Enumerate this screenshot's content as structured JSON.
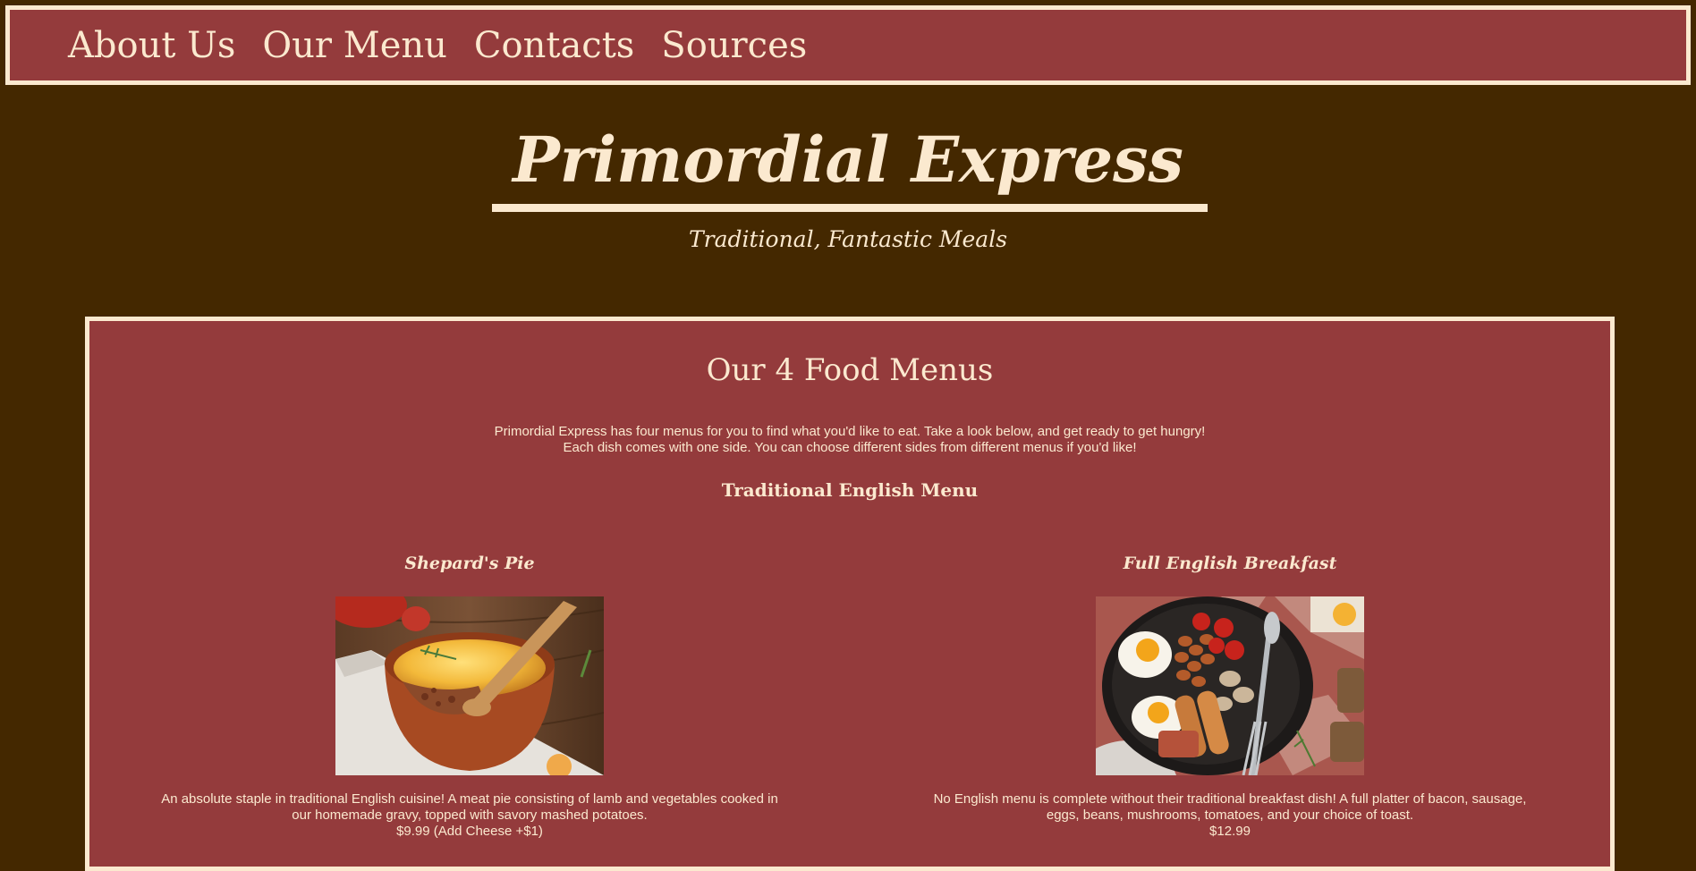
{
  "nav": {
    "items": [
      {
        "label": "About Us"
      },
      {
        "label": "Our Menu"
      },
      {
        "label": "Contacts"
      },
      {
        "label": "Sources"
      }
    ]
  },
  "header": {
    "title": "Primordial Express",
    "tagline": "Traditional, Fantastic Meals"
  },
  "main": {
    "heading": "Our 4 Food Menus",
    "intro_line1": "Primordial Express has four menus for you to find what you'd like to eat. Take a look below, and get ready to get hungry!",
    "intro_line2": "Each dish comes with one side. You can choose different sides from different menus if you'd like!",
    "menu_title": "Traditional English Menu",
    "dishes": [
      {
        "name": "Shepard's Pie",
        "image_icon": "shepherds-pie-photo",
        "description": "An absolute staple in traditional English cuisine! A meat pie consisting of lamb and vegetables cooked in our homemade gravy, topped with savory mashed potatoes.",
        "price": "$9.99 (Add Cheese +$1)"
      },
      {
        "name": "Full English Breakfast",
        "image_icon": "english-breakfast-photo",
        "description": "No English menu is complete without their traditional breakfast dish! A full platter of bacon, sausage, eggs, beans, mushrooms, tomatoes, and your choice of toast.",
        "price": "$12.99"
      }
    ]
  },
  "colors": {
    "background": "#442800",
    "panel": "#943b3c",
    "cream": "#fbe9cf"
  }
}
